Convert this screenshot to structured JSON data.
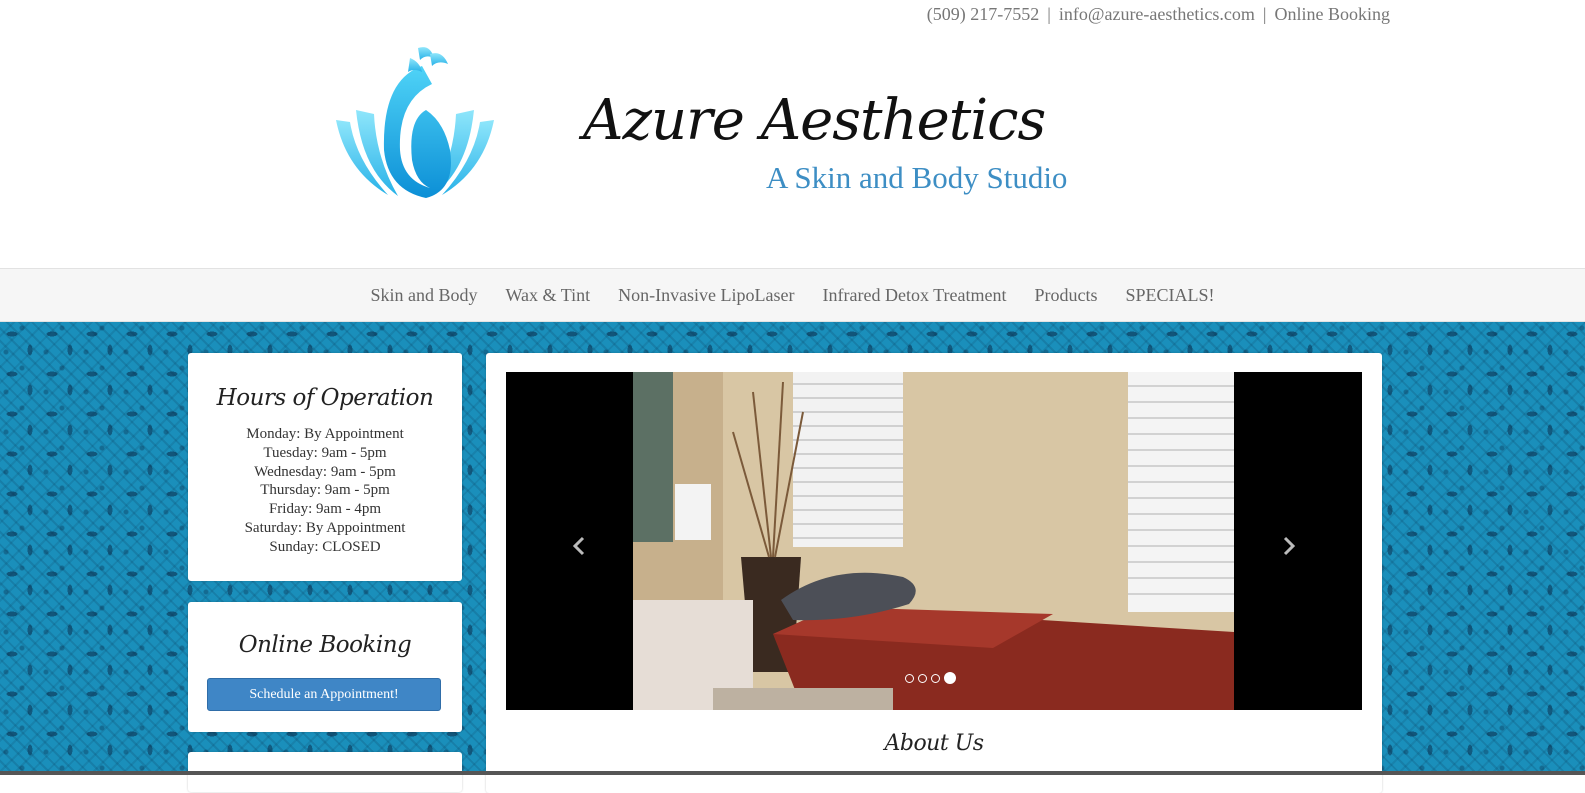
{
  "topbar": {
    "phone": "(509) 217-7552",
    "separator": "|",
    "email": "info@azure-aesthetics.com",
    "booking": "Online Booking"
  },
  "header": {
    "title": "Azure Aesthetics",
    "subtitle": "A Skin and Body Studio",
    "logo_icon": "peacock-logo-icon",
    "accent_color": "#3d8ec4"
  },
  "nav": {
    "items": [
      {
        "label": "Skin and Body"
      },
      {
        "label": "Wax & Tint"
      },
      {
        "label": "Non-Invasive LipoLaser"
      },
      {
        "label": "Infrared Detox Treatment"
      },
      {
        "label": "Products"
      },
      {
        "label": "SPECIALS!"
      }
    ]
  },
  "hours": {
    "title": "Hours of Operation",
    "lines": [
      "Monday: By Appointment",
      "Tuesday: 9am - 5pm",
      "Wednesday: 9am - 5pm",
      "Thursday: 9am - 5pm",
      "Friday: 9am - 4pm",
      "Saturday: By Appointment",
      "Sunday: CLOSED"
    ]
  },
  "booking": {
    "title": "Online Booking",
    "button_label": "Schedule an Appointment!",
    "button_color": "#3f86c6"
  },
  "slider": {
    "prev_icon": "chevron-left-icon",
    "next_icon": "chevron-right-icon",
    "slide_count": 4,
    "active_slide": 4
  },
  "main": {
    "about_title": "About Us"
  },
  "colors": {
    "pattern_background": "#1a8fbb",
    "nav_background": "#f6f6f6"
  }
}
